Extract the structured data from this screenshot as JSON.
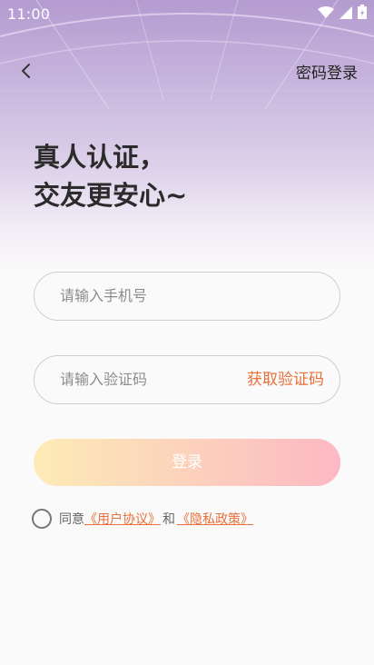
{
  "status_bar": {
    "time": "11:00"
  },
  "nav": {
    "right_action": "密码登录"
  },
  "headline": {
    "line1": "真人认证，",
    "line2": "交友更安心~"
  },
  "phone_field": {
    "placeholder": "请输入手机号"
  },
  "code_field": {
    "placeholder": "请输入验证码",
    "get_code_label": "获取验证码"
  },
  "login_button": {
    "label": "登录"
  },
  "agreement": {
    "prefix": "同意",
    "user_agreement": "《用户协议》",
    "conjunction": "和",
    "privacy_policy": "《隐私政策》"
  },
  "colors": {
    "accent": "#e8703a",
    "button_start": "#fdebb6",
    "button_end": "#fdb8c4"
  }
}
